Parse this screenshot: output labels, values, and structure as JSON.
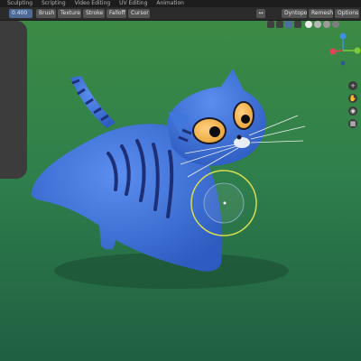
{
  "workspace_tabs": [
    "Sculpting",
    "Scripting",
    "Video Editing",
    "UV Editing",
    "Animation"
  ],
  "toolbar": {
    "strength_value": "0.400",
    "brush_label": "Brush",
    "texture_label": "Texture",
    "stroke_label": "Stroke",
    "falloff_label": "Falloff",
    "cursor_label": "Cursor",
    "dyntopo_label": "Dyntopo",
    "remesh_label": "Remesh",
    "options_label": "Options"
  },
  "colors": {
    "background_green": "#2f7f4c",
    "cat_blue": "#3d72d8",
    "stripe_blue": "#1c2f77",
    "brush_circle": "#d6dc52",
    "axis_x": "#e0455a",
    "axis_y": "#7ccb3a",
    "axis_z": "#3d8fe0"
  },
  "icons": {
    "navigation": [
      "zoom-icon",
      "pan-hand-icon",
      "camera-icon",
      "grid-icon"
    ],
    "header": [
      "viewport-shading-icon",
      "overlays-icon",
      "xray-icon"
    ]
  }
}
